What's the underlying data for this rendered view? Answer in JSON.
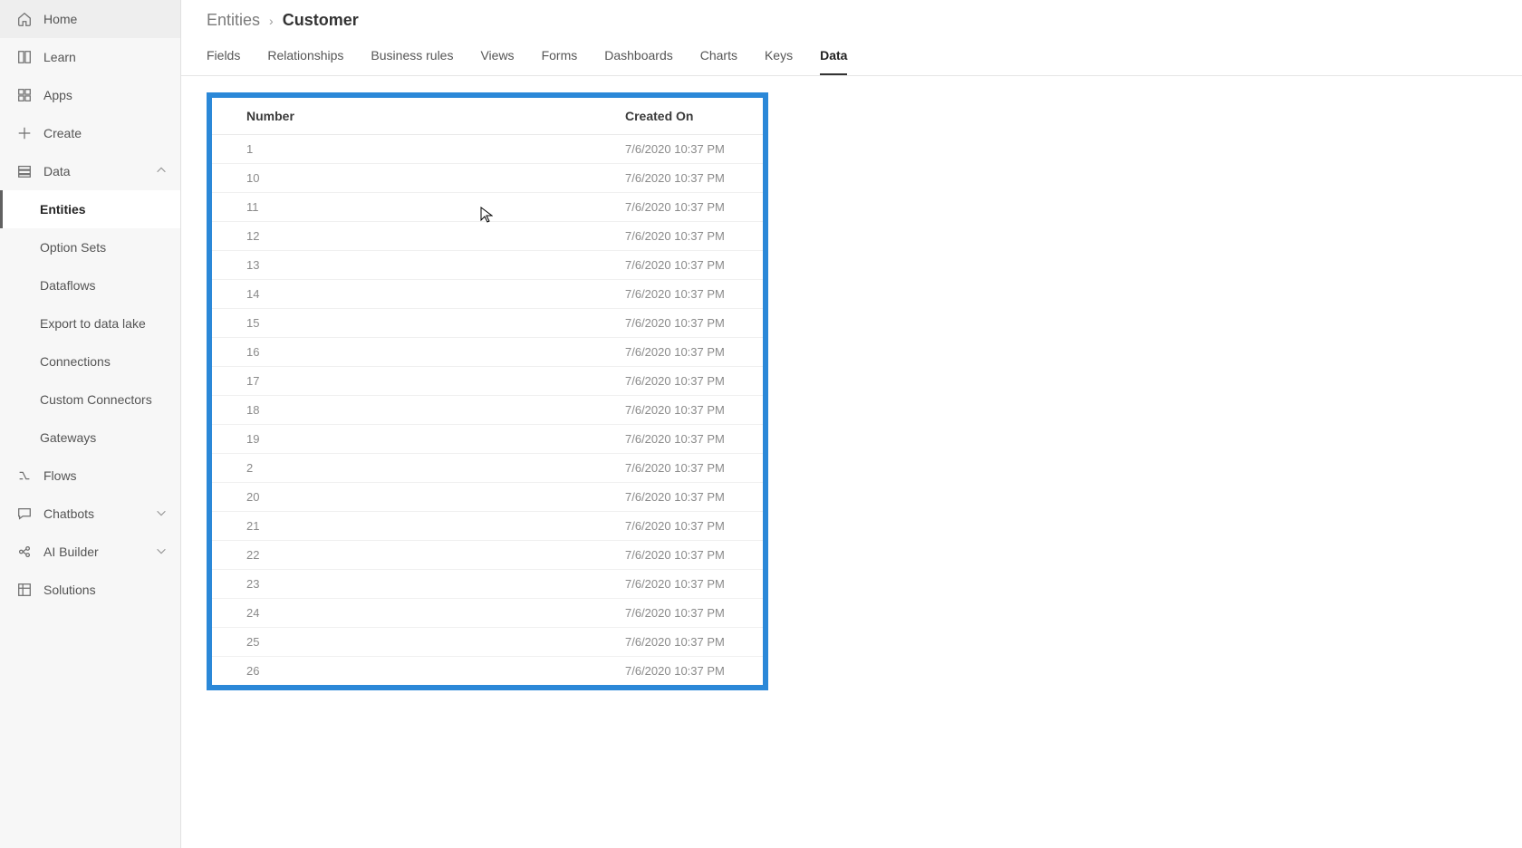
{
  "sidebar": {
    "home": "Home",
    "learn": "Learn",
    "apps": "Apps",
    "create": "Create",
    "data": "Data",
    "data_children": {
      "entities": "Entities",
      "option_sets": "Option Sets",
      "dataflows": "Dataflows",
      "export_lake": "Export to data lake",
      "connections": "Connections",
      "custom_connectors": "Custom Connectors",
      "gateways": "Gateways"
    },
    "flows": "Flows",
    "chatbots": "Chatbots",
    "ai_builder": "AI Builder",
    "solutions": "Solutions"
  },
  "breadcrumb": {
    "root": "Entities",
    "current": "Customer"
  },
  "tabs": {
    "fields": "Fields",
    "relationships": "Relationships",
    "business_rules": "Business rules",
    "views": "Views",
    "forms": "Forms",
    "dashboards": "Dashboards",
    "charts": "Charts",
    "keys": "Keys",
    "data": "Data"
  },
  "table": {
    "headers": {
      "number": "Number",
      "created_on": "Created On"
    },
    "rows": [
      {
        "number": "1",
        "created_on": "7/6/2020 10:37 PM"
      },
      {
        "number": "10",
        "created_on": "7/6/2020 10:37 PM"
      },
      {
        "number": "11",
        "created_on": "7/6/2020 10:37 PM"
      },
      {
        "number": "12",
        "created_on": "7/6/2020 10:37 PM"
      },
      {
        "number": "13",
        "created_on": "7/6/2020 10:37 PM"
      },
      {
        "number": "14",
        "created_on": "7/6/2020 10:37 PM"
      },
      {
        "number": "15",
        "created_on": "7/6/2020 10:37 PM"
      },
      {
        "number": "16",
        "created_on": "7/6/2020 10:37 PM"
      },
      {
        "number": "17",
        "created_on": "7/6/2020 10:37 PM"
      },
      {
        "number": "18",
        "created_on": "7/6/2020 10:37 PM"
      },
      {
        "number": "19",
        "created_on": "7/6/2020 10:37 PM"
      },
      {
        "number": "2",
        "created_on": "7/6/2020 10:37 PM"
      },
      {
        "number": "20",
        "created_on": "7/6/2020 10:37 PM"
      },
      {
        "number": "21",
        "created_on": "7/6/2020 10:37 PM"
      },
      {
        "number": "22",
        "created_on": "7/6/2020 10:37 PM"
      },
      {
        "number": "23",
        "created_on": "7/6/2020 10:37 PM"
      },
      {
        "number": "24",
        "created_on": "7/6/2020 10:37 PM"
      },
      {
        "number": "25",
        "created_on": "7/6/2020 10:37 PM"
      },
      {
        "number": "26",
        "created_on": "7/6/2020 10:37 PM"
      }
    ]
  }
}
